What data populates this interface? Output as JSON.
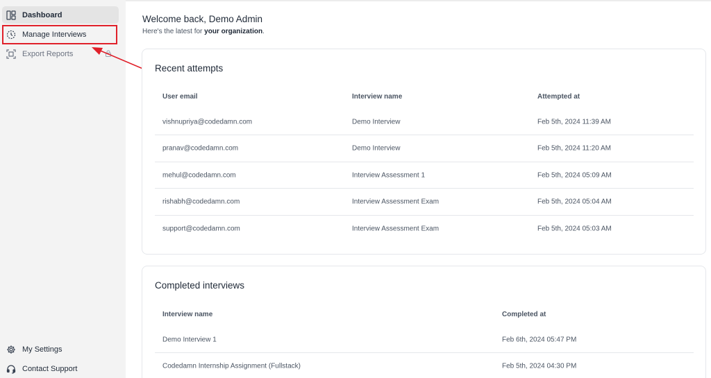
{
  "sidebar": {
    "items": [
      {
        "label": "Dashboard",
        "icon": "dashboard-icon"
      },
      {
        "label": "Manage Interviews",
        "icon": "timer-icon"
      },
      {
        "label": "Export Reports",
        "icon": "export-icon",
        "locked": true
      }
    ],
    "bottom_items": [
      {
        "label": "My Settings",
        "icon": "gear-icon"
      },
      {
        "label": "Contact Support",
        "icon": "headset-icon"
      }
    ]
  },
  "header": {
    "welcome": "Welcome back, Demo Admin",
    "subtitle_prefix": "Here's the latest for ",
    "subtitle_bold": "your organization",
    "subtitle_suffix": "."
  },
  "recent_attempts": {
    "title": "Recent attempts",
    "columns": [
      "User email",
      "Interview name",
      "Attempted at"
    ],
    "rows": [
      [
        "vishnupriya@codedamn.com",
        "Demo Interview",
        "Feb 5th, 2024 11:39 AM"
      ],
      [
        "pranav@codedamn.com",
        "Demo Interview",
        "Feb 5th, 2024 11:20 AM"
      ],
      [
        "mehul@codedamn.com",
        "Interview Assessment 1",
        "Feb 5th, 2024 05:09 AM"
      ],
      [
        "rishabh@codedamn.com",
        "Interview Assessment Exam",
        "Feb 5th, 2024 05:04 AM"
      ],
      [
        "support@codedamn.com",
        "Interview Assessment Exam",
        "Feb 5th, 2024 05:03 AM"
      ]
    ]
  },
  "completed_interviews": {
    "title": "Completed interviews",
    "columns": [
      "Interview name",
      "Completed at"
    ],
    "rows": [
      [
        "Demo Interview 1",
        "Feb 6th, 2024 05:47 PM"
      ],
      [
        "Codedamn Internship Assignment (Fullstack)",
        "Feb 5th, 2024 04:30 PM"
      ]
    ]
  },
  "colors": {
    "sidebar_bg": "#f3f3f3",
    "active_item_bg": "#e4e4e4",
    "annotation_red": "#e0202a"
  }
}
